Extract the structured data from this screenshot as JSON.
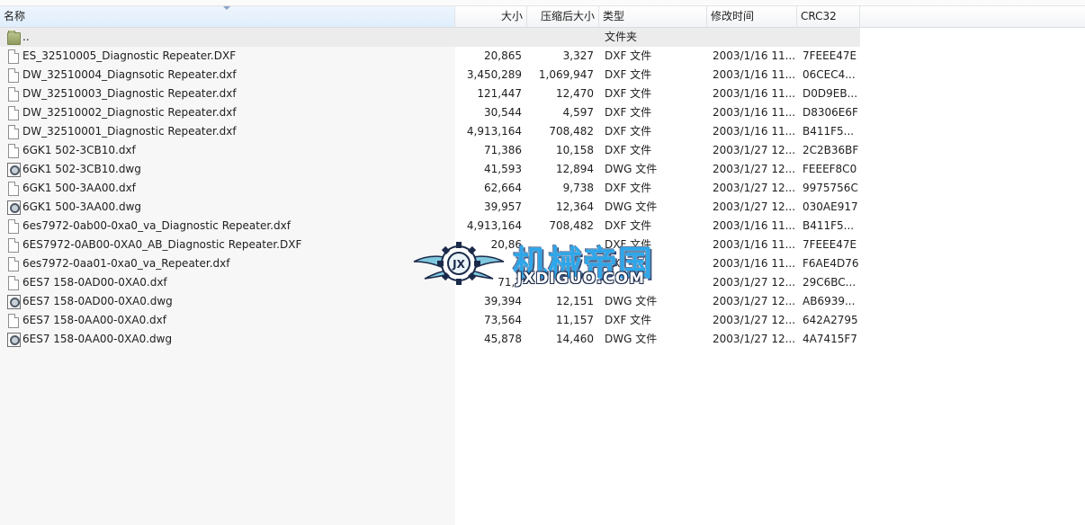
{
  "columns": {
    "name": "名称",
    "size": "大小",
    "packed": "压缩后大小",
    "type": "类型",
    "modified": "修改时间",
    "crc": "CRC32"
  },
  "parent_row": {
    "name": "..",
    "type": "文件夹",
    "icon": "folder-icon"
  },
  "files": [
    {
      "name": "ES_32510005_Diagnostic Repeater.DXF",
      "size": "20,865",
      "packed": "3,327",
      "type": "DXF 文件",
      "modified": "2003/1/16 11...",
      "crc": "7FEEE47E",
      "icon": "document-icon"
    },
    {
      "name": "DW_32510004_Diagnsotic Repeater.dxf",
      "size": "3,450,289",
      "packed": "1,069,947",
      "type": "DXF 文件",
      "modified": "2003/1/16 11...",
      "crc": "06CEC4...",
      "icon": "document-icon"
    },
    {
      "name": "DW_32510003_Diagnostic Repeater.dxf",
      "size": "121,447",
      "packed": "12,470",
      "type": "DXF 文件",
      "modified": "2003/1/16 11...",
      "crc": "D0D9EB...",
      "icon": "document-icon"
    },
    {
      "name": "DW_32510002_Diagnostic Repeater.dxf",
      "size": "30,544",
      "packed": "4,597",
      "type": "DXF 文件",
      "modified": "2003/1/16 11...",
      "crc": "D8306E6F",
      "icon": "document-icon"
    },
    {
      "name": "DW_32510001_Diagnostic Repeater.dxf",
      "size": "4,913,164",
      "packed": "708,482",
      "type": "DXF 文件",
      "modified": "2003/1/16 11...",
      "crc": "B411F5...",
      "icon": "document-icon"
    },
    {
      "name": "6GK1 502-3CB10.dxf",
      "size": "71,386",
      "packed": "10,158",
      "type": "DXF 文件",
      "modified": "2003/1/27 12...",
      "crc": "2C2B36BF",
      "icon": "document-icon"
    },
    {
      "name": "6GK1 502-3CB10.dwg",
      "size": "41,593",
      "packed": "12,894",
      "type": "DWG 文件",
      "modified": "2003/1/27 12...",
      "crc": "FEEEF8C0",
      "icon": "dwg-icon"
    },
    {
      "name": "6GK1 500-3AA00.dxf",
      "size": "62,664",
      "packed": "9,738",
      "type": "DXF 文件",
      "modified": "2003/1/27 12...",
      "crc": "9975756C",
      "icon": "document-icon"
    },
    {
      "name": "6GK1 500-3AA00.dwg",
      "size": "39,957",
      "packed": "12,364",
      "type": "DWG 文件",
      "modified": "2003/1/27 12...",
      "crc": "030AE917",
      "icon": "dwg-icon"
    },
    {
      "name": "6es7972-0ab00-0xa0_va_Diagnostic Repeater.dxf",
      "size": "4,913,164",
      "packed": "708,482",
      "type": "DXF 文件",
      "modified": "2003/1/16 11...",
      "crc": "B411F5...",
      "icon": "document-icon"
    },
    {
      "name": "6ES7972-0AB00-0XA0_AB_Diagnostic Repeater.DXF",
      "size": "20,86",
      "packed": "",
      "type": "DXF 文件",
      "modified": "2003/1/16 11...",
      "crc": "7FEEE47E",
      "icon": "document-icon"
    },
    {
      "name": "6es7972-0aa01-0xa0_va_Repeater.dxf",
      "size": "",
      "packed": "",
      "type": "DXF 文件",
      "modified": "2003/1/16 11...",
      "crc": "F6AE4D76",
      "icon": "document-icon"
    },
    {
      "name": "6ES7 158-0AD00-0XA0.dxf",
      "size": "71,2",
      "packed": "",
      "type": "",
      "modified": "2003/1/27 12...",
      "crc": "29C6BC...",
      "icon": "document-icon"
    },
    {
      "name": "6ES7 158-0AD00-0XA0.dwg",
      "size": "39,394",
      "packed": "12,151",
      "type": "DWG 文件",
      "modified": "2003/1/27 12...",
      "crc": "AB6939...",
      "icon": "dwg-icon"
    },
    {
      "name": "6ES7 158-0AA00-0XA0.dxf",
      "size": "73,564",
      "packed": "11,157",
      "type": "DXF 文件",
      "modified": "2003/1/27 12...",
      "crc": "642A2795",
      "icon": "document-icon"
    },
    {
      "name": "6ES7 158-0AA00-0XA0.dwg",
      "size": "45,878",
      "packed": "14,460",
      "type": "DWG 文件",
      "modified": "2003/1/27 12...",
      "crc": "4A7415F7",
      "icon": "dwg-icon"
    }
  ],
  "watermark": {
    "title": "机械帝国",
    "url": "JXDIGUO.COM",
    "emblem_letters": "JX",
    "icon": "winged-gear-logo-icon"
  },
  "colors": {
    "header_selected": "#dfeefc",
    "name_column_bg": "#f7f7f7",
    "watermark_blue": "#2ea6e9"
  }
}
